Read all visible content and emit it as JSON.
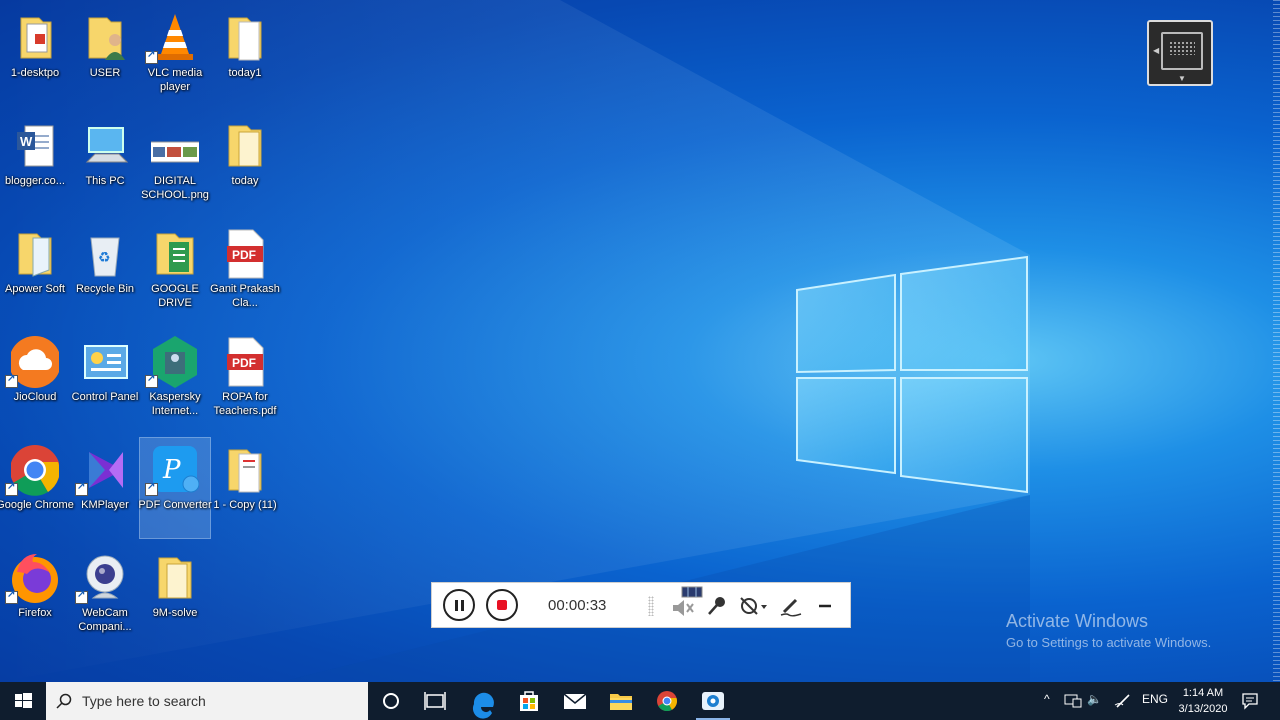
{
  "desktop": {
    "icons": [
      {
        "label": "1-desktpo"
      },
      {
        "label": "USER"
      },
      {
        "label": "VLC media player"
      },
      {
        "label": "today1"
      },
      {
        "label": "blogger.co..."
      },
      {
        "label": "This PC"
      },
      {
        "label": "DIGITAL SCHOOL.png"
      },
      {
        "label": "today"
      },
      {
        "label": "Apower Soft"
      },
      {
        "label": "Recycle Bin"
      },
      {
        "label": "GOOGLE DRIVE"
      },
      {
        "label": "Ganit Prakash Cla..."
      },
      {
        "label": "JioCloud"
      },
      {
        "label": "Control Panel"
      },
      {
        "label": "Kaspersky Internet..."
      },
      {
        "label": "ROPA for Teachers.pdf"
      },
      {
        "label": "Google Chrome"
      },
      {
        "label": "KMPlayer"
      },
      {
        "label": "PDF Converter"
      },
      {
        "label": "1 - Copy (11)"
      },
      {
        "label": "Firefox"
      },
      {
        "label": "WebCam Compani..."
      },
      {
        "label": "9M-solve"
      }
    ],
    "pdf_badge": "PDF"
  },
  "recorder": {
    "timer": "00:00:33"
  },
  "watermark": {
    "title": "Activate Windows",
    "subtitle": "Go to Settings to activate Windows."
  },
  "taskbar": {
    "search_placeholder": "Type here to search",
    "language": "ENG",
    "time": "1:14 AM",
    "date": "3/13/2020"
  },
  "colors": {
    "taskbar": "#0f1d2e",
    "recorder_stop": "#e81123",
    "accent": "#0a63cf"
  }
}
